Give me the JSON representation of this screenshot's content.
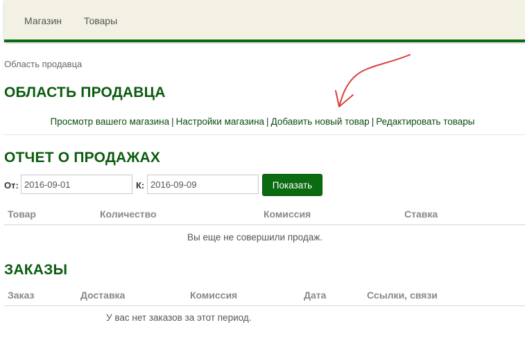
{
  "nav": {
    "items": [
      "Магазин",
      "Товары"
    ]
  },
  "breadcrumb": "Область продавца",
  "vendor": {
    "title": "ОБЛАСТЬ ПРОДАВЦА",
    "links": [
      "Просмотр вашего магазина",
      "Настройки магазина",
      "Добавить новый товар",
      "Редактировать товары"
    ],
    "separator": "|"
  },
  "sales": {
    "title": "ОТЧЕТ О ПРОДАЖАХ",
    "from_label": "От:",
    "from_value": "2016-09-01",
    "to_label": "К:",
    "to_value": "2016-09-09",
    "show_button": "Показать",
    "columns": [
      "Товар",
      "Количество",
      "Комиссия",
      "Ставка"
    ],
    "empty_text": "Вы еще не совершили продаж."
  },
  "orders": {
    "title": "ЗАКАЗЫ",
    "columns": [
      "Заказ",
      "Доставка",
      "Комиссия",
      "Дата",
      "Ссылки, связи"
    ],
    "empty_text": "У вас нет заказов за этот период."
  },
  "colors": {
    "brand_green": "#0b6b10",
    "heading_green": "#0b5b0f",
    "annotation_red": "#d9403a",
    "topbar_bg": "#f3f1e4"
  },
  "annotation": {
    "icon": "red-arrow-icon"
  }
}
